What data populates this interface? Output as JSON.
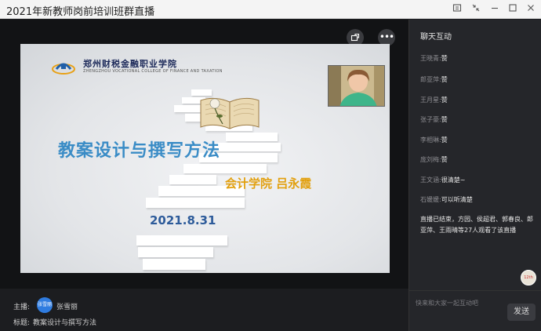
{
  "window": {
    "title": "2021年新教师岗前培训班群直播",
    "icons": [
      "save-icon",
      "collapse-icon",
      "minimize-icon",
      "maximize-icon",
      "close-icon"
    ]
  },
  "video": {
    "slide": {
      "school_cn": "郑州财税金融职业学院",
      "school_en": "ZHENGZHOU VOCATIONAL COLLEGE OF FINANCE AND TAXATION",
      "title": "教案设计与撰写方法",
      "author": "会计学院 吕永霞",
      "date": "2021.8.31"
    }
  },
  "host": {
    "host_label": "主播:",
    "host_avatar_text": "张雪丽",
    "host_name": "张雪丽",
    "topic_label": "标题:",
    "topic": "教案设计与撰写方法"
  },
  "chat": {
    "title": "聊天互动",
    "messages": [
      {
        "name": "王晓青:",
        "text": "赞"
      },
      {
        "name": "郎亚萍:",
        "text": "赞"
      },
      {
        "name": "王月星:",
        "text": "赞"
      },
      {
        "name": "张子豪:",
        "text": "赞"
      },
      {
        "name": "李相琳:",
        "text": "赞"
      },
      {
        "name": "庞刘梅:",
        "text": "赞"
      },
      {
        "name": "王文涵:",
        "text": "很清楚~"
      },
      {
        "name": "石媛媛:",
        "text": "可以听清楚"
      }
    ],
    "notice": "直播已结束，方园、侯超君、郭春良、郎亚萍、王雨晴等27人观看了该直播",
    "bottom_avatar_text": "12th",
    "input_placeholder": "快来和大家一起互动吧",
    "send_label": "发送"
  },
  "colors": {
    "accent_blue": "#3a8cc6",
    "author_gold": "#e2a00f",
    "date_blue": "#2d5b9a",
    "panel_dark": "#25262a"
  }
}
